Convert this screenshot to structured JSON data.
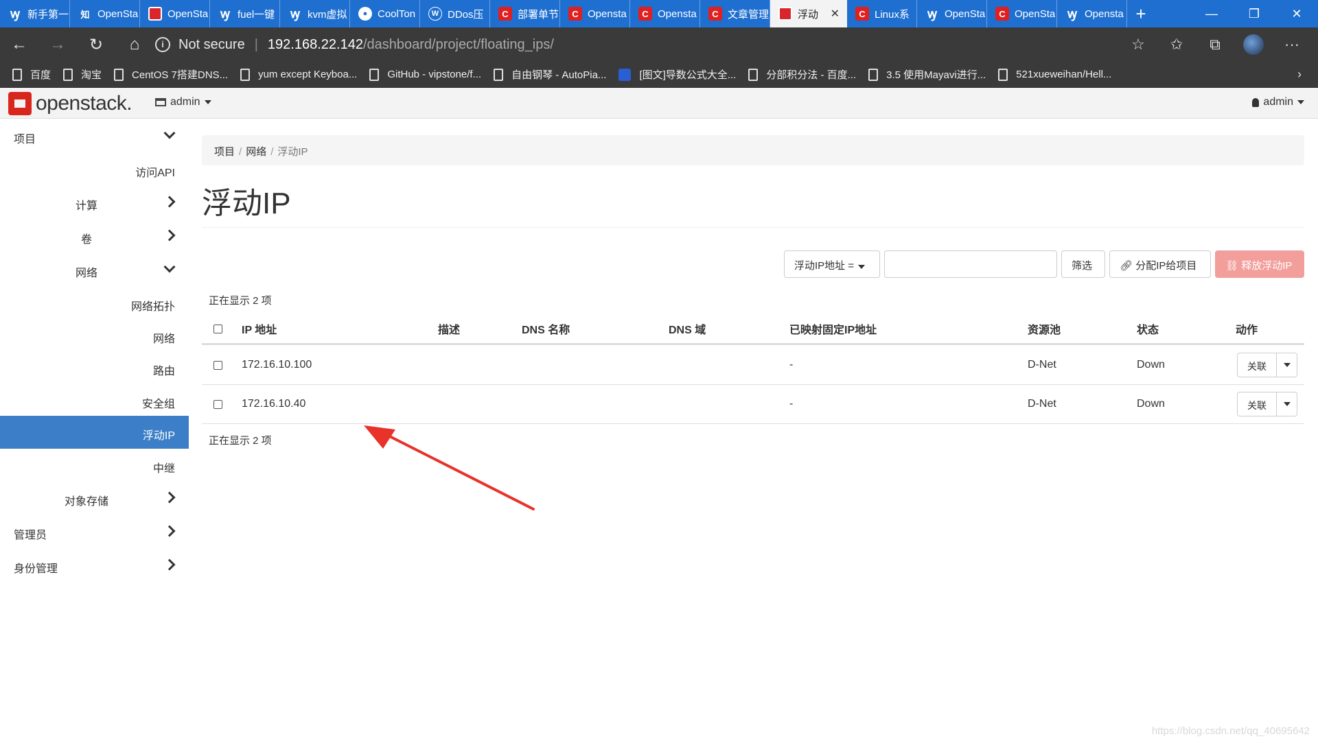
{
  "browser": {
    "tabs": [
      {
        "label": "新手第一",
        "icon": "w"
      },
      {
        "label": "OpenSta",
        "icon": "zhi"
      },
      {
        "label": "OpenSta",
        "icon": "os"
      },
      {
        "label": "fuel一键",
        "icon": "w"
      },
      {
        "label": "kvm虚拟",
        "icon": "w"
      },
      {
        "label": "CoolTon",
        "icon": "github"
      },
      {
        "label": "DDos压",
        "icon": "wp"
      },
      {
        "label": "部署单节",
        "icon": "c"
      },
      {
        "label": "Opensta",
        "icon": "c"
      },
      {
        "label": "Opensta",
        "icon": "c"
      },
      {
        "label": "文章管理",
        "icon": "c"
      },
      {
        "label": "浮动",
        "icon": "os",
        "active": true
      },
      {
        "label": "Linux系",
        "icon": "c"
      },
      {
        "label": "OpenSta",
        "icon": "w"
      },
      {
        "label": "OpenSta",
        "icon": "c"
      },
      {
        "label": "Opensta",
        "icon": "w"
      }
    ],
    "zhi_glyph": "知",
    "not_secure": "Not secure",
    "url_host": "192.168.22.142",
    "url_path": "/dashboard/project/floating_ips/",
    "bookmarks": [
      "百度",
      "淘宝",
      "CentOS 7搭建DNS...",
      "yum except Keyboa...",
      "GitHub - vipstone/f...",
      "自由钢琴 - AutoPia...",
      "[图文]导数公式大全...",
      "分部积分法 - 百度...",
      "3.5 使用Mayavi进行...",
      "521xueweihan/Hell..."
    ]
  },
  "header": {
    "logo_text": "openstack.",
    "project": "admin",
    "user": "admin"
  },
  "sidebar": {
    "project": "项目",
    "api_access": "访问API",
    "compute": "计算",
    "volumes": "卷",
    "network": "网络",
    "network_topology": "网络拓扑",
    "networks": "网络",
    "routers": "路由",
    "security_groups": "安全组",
    "floating_ips": "浮动IP",
    "trunks": "中继",
    "object_store": "对象存储",
    "admin": "管理员",
    "identity": "身份管理"
  },
  "main": {
    "breadcrumb": [
      "项目",
      "网络",
      "浮动IP"
    ],
    "title": "浮动IP",
    "filter_field": "浮动IP地址 =",
    "filter_button": "筛选",
    "allocate_button": "分配IP给项目",
    "release_button": "释放浮动IP",
    "count_text": "正在显示 2 项",
    "columns": [
      "IP 地址",
      "描述",
      "DNS 名称",
      "DNS 域",
      "已映射固定IP地址",
      "资源池",
      "状态",
      "动作"
    ],
    "rows": [
      {
        "ip": "172.16.10.100",
        "mapped": "-",
        "pool": "D-Net",
        "status": "Down",
        "action": "关联"
      },
      {
        "ip": "172.16.10.40",
        "mapped": "-",
        "pool": "D-Net",
        "status": "Down",
        "action": "关联"
      }
    ]
  },
  "colors": {
    "tabbar": "#1e6fd0",
    "active_nav": "#3c7fc8",
    "danger_button": "#f29e9a",
    "annotation_arrow": "#e8322a"
  },
  "watermark": "https://blog.csdn.net/qq_40695642"
}
